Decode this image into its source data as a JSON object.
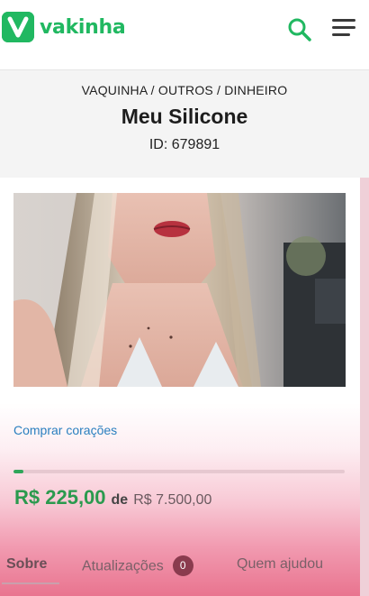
{
  "header": {
    "logo_text": "vakinha",
    "logo_letter": "V",
    "brand_color": "#21b861",
    "search_icon": "search-icon",
    "menu_icon": "hamburger-menu-icon"
  },
  "campaign": {
    "breadcrumb": [
      "VAQUINHA",
      "OUTROS",
      "DINHEIRO"
    ],
    "breadcrumb_separator": " / ",
    "title": "Meu Silicone",
    "id_text": "ID: 679891"
  },
  "actions": {
    "buy_hearts": "Comprar corações"
  },
  "progress": {
    "raised": "R$ 225,00",
    "connector": "de",
    "goal": "R$ 7.500,00",
    "fraction": 0.03,
    "fill_color": "#2fa65a"
  },
  "tabs": [
    {
      "label": "Sobre",
      "active": true
    },
    {
      "label": "Atualizações",
      "active": false,
      "badge": "0"
    },
    {
      "label": "Quem ajudou",
      "active": false
    }
  ]
}
